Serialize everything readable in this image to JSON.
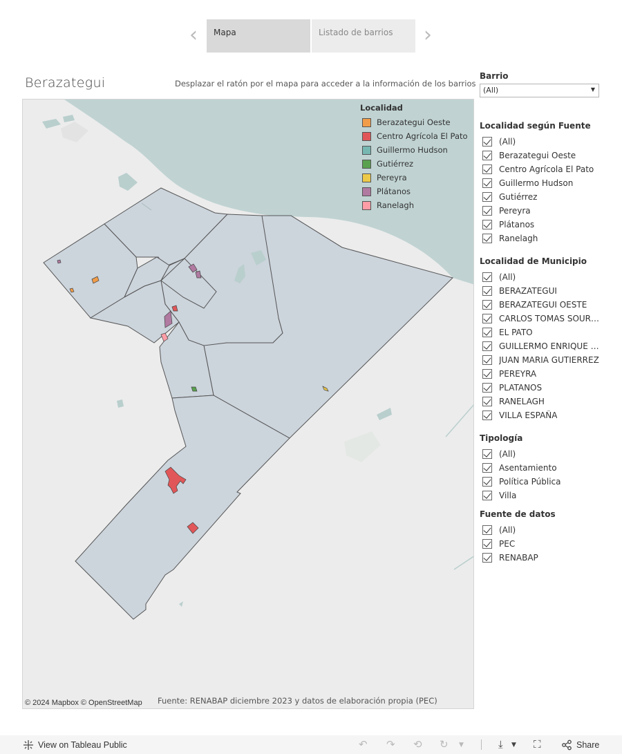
{
  "story_nav": {
    "tabs": [
      {
        "label": "Mapa",
        "active": true
      },
      {
        "label": "Listado de barrios",
        "active": false
      }
    ]
  },
  "header": {
    "title": "Berazategui",
    "hint": "Desplazar el ratón por el mapa para acceder a la información de los barrios"
  },
  "map": {
    "legend": {
      "title": "Localidad",
      "items": [
        {
          "label": "Berazategui Oeste",
          "color": "#f19c49"
        },
        {
          "label": "Centro Agrícola El Pato",
          "color": "#e15759"
        },
        {
          "label": "Guillermo Hudson",
          "color": "#76b7b2"
        },
        {
          "label": "Gutiérrez",
          "color": "#59a14f"
        },
        {
          "label": "Pereyra",
          "color": "#edc948"
        },
        {
          "label": "Plátanos",
          "color": "#b07aa1"
        },
        {
          "label": "Ranelagh",
          "color": "#ff9da7"
        }
      ]
    },
    "attribution": "© 2024 Mapbox  © OpenStreetMap",
    "source": "Fuente: RENABAP diciembre 2023 y datos de elaboración propia (PEC)",
    "colors": {
      "land": "#ececec",
      "water": "#c0d3d2",
      "district": "#ccd4dc",
      "border": "#555555"
    }
  },
  "filters": {
    "barrio": {
      "label": "Barrio",
      "value": "(All)"
    },
    "groups": [
      {
        "label": "Localidad según Fuente",
        "items": [
          "(All)",
          "Berazategui Oeste",
          "Centro Agrícola El Pato",
          "Guillermo Hudson",
          "Gutiérrez",
          "Pereyra",
          "Plátanos",
          "Ranelagh"
        ]
      },
      {
        "label": "Localidad de Municipio",
        "items": [
          "(All)",
          "BERAZATEGUI",
          "BERAZATEGUI OESTE",
          "CARLOS TOMAS SOURIG...",
          "EL PATO",
          "GUILLERMO ENRIQUE H...",
          "JUAN MARIA GUTIERREZ",
          "PEREYRA",
          "PLATANOS",
          "RANELAGH",
          "VILLA ESPAÑA"
        ]
      },
      {
        "label": "Tipología",
        "items": [
          "(All)",
          "Asentamiento",
          "Política Pública",
          "Villa"
        ]
      },
      {
        "label": "Fuente de datos",
        "items": [
          "(All)",
          "PEC",
          "RENABAP"
        ]
      }
    ]
  },
  "toolbar": {
    "view_label": "View on Tableau Public",
    "share_label": "Share",
    "icons": [
      "undo-icon",
      "redo-icon",
      "revert-icon",
      "refresh-icon",
      "download-icon",
      "fullscreen-icon",
      "share-icon"
    ]
  }
}
